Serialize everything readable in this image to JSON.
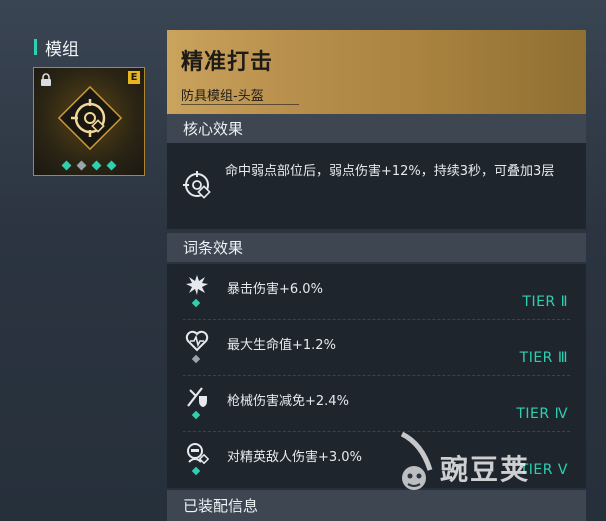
{
  "left": {
    "heading": "模组",
    "card": {
      "grade": "E",
      "socket_dots": [
        "#2fd0b1",
        "#9aa4ad",
        "#2fd0b1",
        "#2fd0b1"
      ]
    }
  },
  "title": {
    "name": "精准打击",
    "subtitle": "防具模组-头盔"
  },
  "core": {
    "header": "核心效果",
    "icon": "precision-crosshair-icon",
    "description": "命中弱点部位后，弱点伤害+12%，持续3秒，可叠加3层"
  },
  "affixes": {
    "header": "词条效果",
    "items": [
      {
        "icon": "explosion-icon",
        "text": "暴击伤害+6.0%",
        "tier": "TIER Ⅱ",
        "dot_color": "#2fd0b1"
      },
      {
        "icon": "heart-pulse-icon",
        "text": "最大生命值+1.2%",
        "tier": "TIER Ⅲ",
        "dot_color": "#9aa4ad"
      },
      {
        "icon": "gun-shield-icon",
        "text": "枪械伤害减免+2.4%",
        "tier": "TIER Ⅳ",
        "dot_color": "#2fd0b1"
      },
      {
        "icon": "elite-enemy-icon",
        "text": "对精英敌人伤害+3.0%",
        "tier": "TIER Ⅴ",
        "dot_color": "#2fd0b1"
      }
    ]
  },
  "equip": {
    "header": "已装配信息"
  },
  "watermark": {
    "text": "豌豆荚"
  },
  "colors": {
    "accent": "#2fd0b1",
    "gold": "#caa35d"
  }
}
